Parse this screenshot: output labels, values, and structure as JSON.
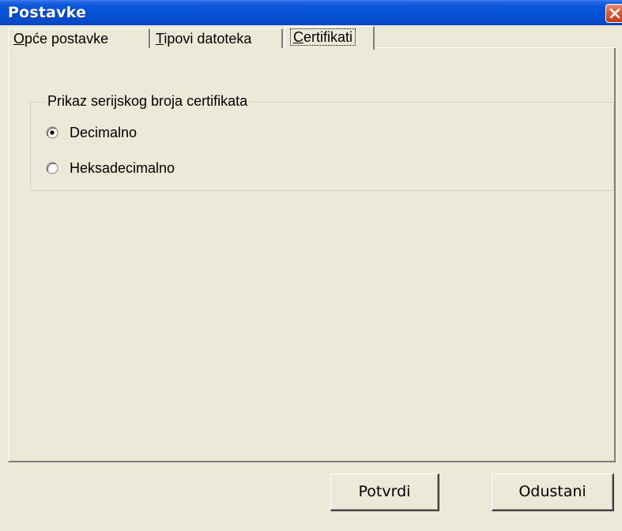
{
  "window": {
    "title": "Postavke",
    "close_icon": "close-icon"
  },
  "tabs": [
    {
      "mnemonic": "O",
      "rest": "pće postavke",
      "selected": false
    },
    {
      "mnemonic": "T",
      "rest": "ipovi datoteka",
      "selected": false
    },
    {
      "mnemonic": "C",
      "rest": "ertifikati",
      "selected": true
    }
  ],
  "group": {
    "title": "Prikaz serijskog broja certifikata",
    "options": [
      {
        "label": "Decimalno",
        "checked": true
      },
      {
        "label": "Heksadecimalno",
        "checked": false
      }
    ]
  },
  "buttons": {
    "ok_label": "Potvrdi",
    "cancel_label": "Odustani"
  },
  "colors": {
    "title_bar": "#0451d5",
    "dialog_face": "#ece9d8",
    "close_button": "#d8522e"
  }
}
